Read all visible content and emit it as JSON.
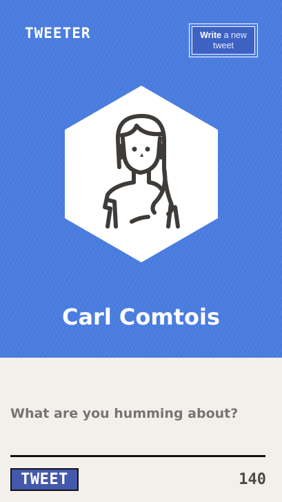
{
  "header": {
    "logo_text": "TWEETER",
    "write_button": {
      "bold": "Write",
      "rest": "a new",
      "line2": "tweet"
    }
  },
  "profile": {
    "name": "Carl Comtois",
    "avatar_icon": "woman-avatar-icon"
  },
  "composer": {
    "placeholder": "What are you humming about?",
    "value": "",
    "tweet_button": "TWEET",
    "char_count": "140"
  },
  "colors": {
    "hero_bg": "#4a7de0",
    "button_bg": "#4458ac",
    "panel_bg": "#f3f0eb",
    "text_dark": "#4d4a47"
  }
}
